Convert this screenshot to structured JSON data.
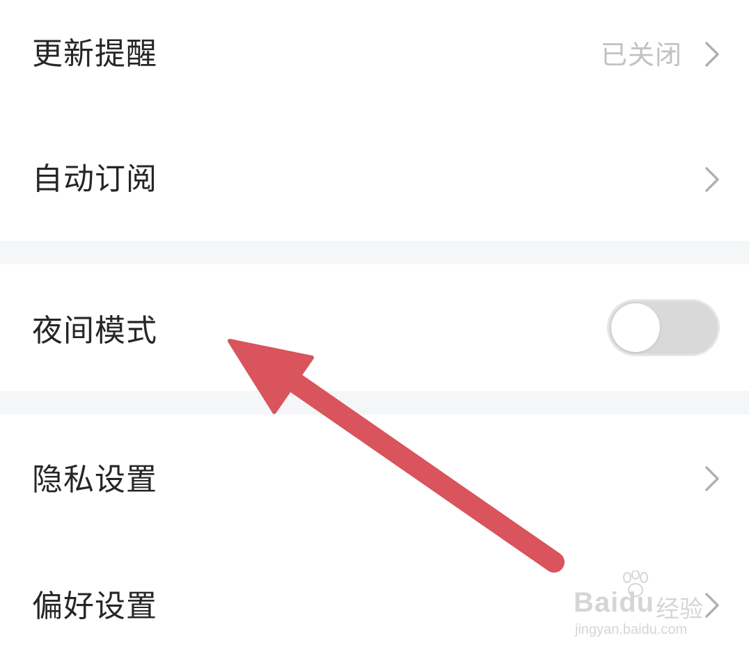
{
  "settings": {
    "items": [
      {
        "label": "更新提醒",
        "value": "已关闭",
        "control": "chevron"
      },
      {
        "label": "自动订阅",
        "value": "",
        "control": "chevron"
      },
      {
        "label": "夜间模式",
        "value": "",
        "control": "toggle",
        "toggle_on": false
      },
      {
        "label": "隐私设置",
        "value": "",
        "control": "chevron"
      },
      {
        "label": "偏好设置",
        "value": "",
        "control": "chevron"
      }
    ]
  },
  "icons": {
    "chevron": "chevron-right-icon",
    "annotation": "red-arrow"
  },
  "watermark": {
    "brand": "Baidu",
    "brand_cn": "经验",
    "url": "jingyan.baidu.com"
  },
  "colors": {
    "background": "#ffffff",
    "section_gap": "#f5f6f8",
    "label_text": "#262626",
    "value_text": "#c2c2c2",
    "chevron": "#b0b0b0",
    "toggle_track_off": "#d9d9d9",
    "arrow_annotation": "#d9545c"
  }
}
